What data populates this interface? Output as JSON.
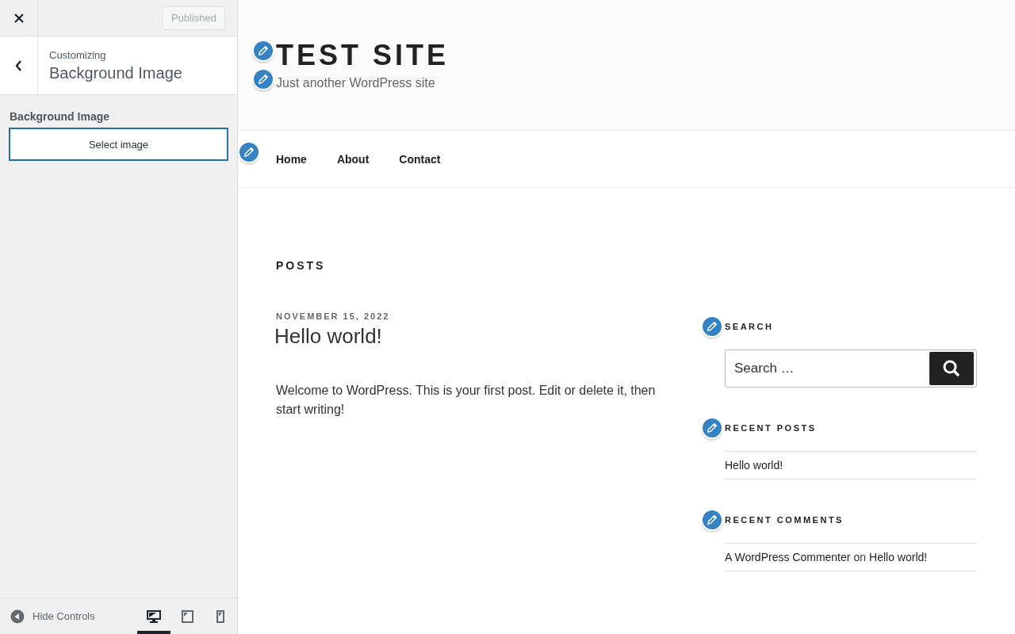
{
  "customizer": {
    "publish_button": "Published",
    "breadcrumb": "Customizing",
    "section_title": "Background Image",
    "control_label": "Background Image",
    "select_button": "Select image",
    "hide_controls": "Hide Controls",
    "devices": [
      {
        "kind": "desktop",
        "selected": true
      },
      {
        "kind": "tablet",
        "selected": false
      },
      {
        "kind": "mobile",
        "selected": false
      }
    ]
  },
  "site": {
    "title": "TEST SITE",
    "tagline": "Just another WordPress site",
    "menu": [
      "Home",
      "About",
      "Contact"
    ],
    "page_heading": "POSTS",
    "post": {
      "date": "NOVEMBER 15, 2022",
      "title": "Hello world!",
      "excerpt": "Welcome to WordPress. This is your first post. Edit or delete it, then start writing!"
    },
    "widgets": [
      {
        "kind": "search",
        "title": "SEARCH",
        "placeholder": "Search …"
      },
      {
        "kind": "list",
        "title": "RECENT POSTS",
        "items": [
          "Hello world!"
        ]
      },
      {
        "kind": "comments",
        "title": "RECENT COMMENTS",
        "items": [
          {
            "author": "A WordPress Commenter",
            "joiner": "on",
            "post": "Hello world!"
          }
        ]
      }
    ]
  }
}
